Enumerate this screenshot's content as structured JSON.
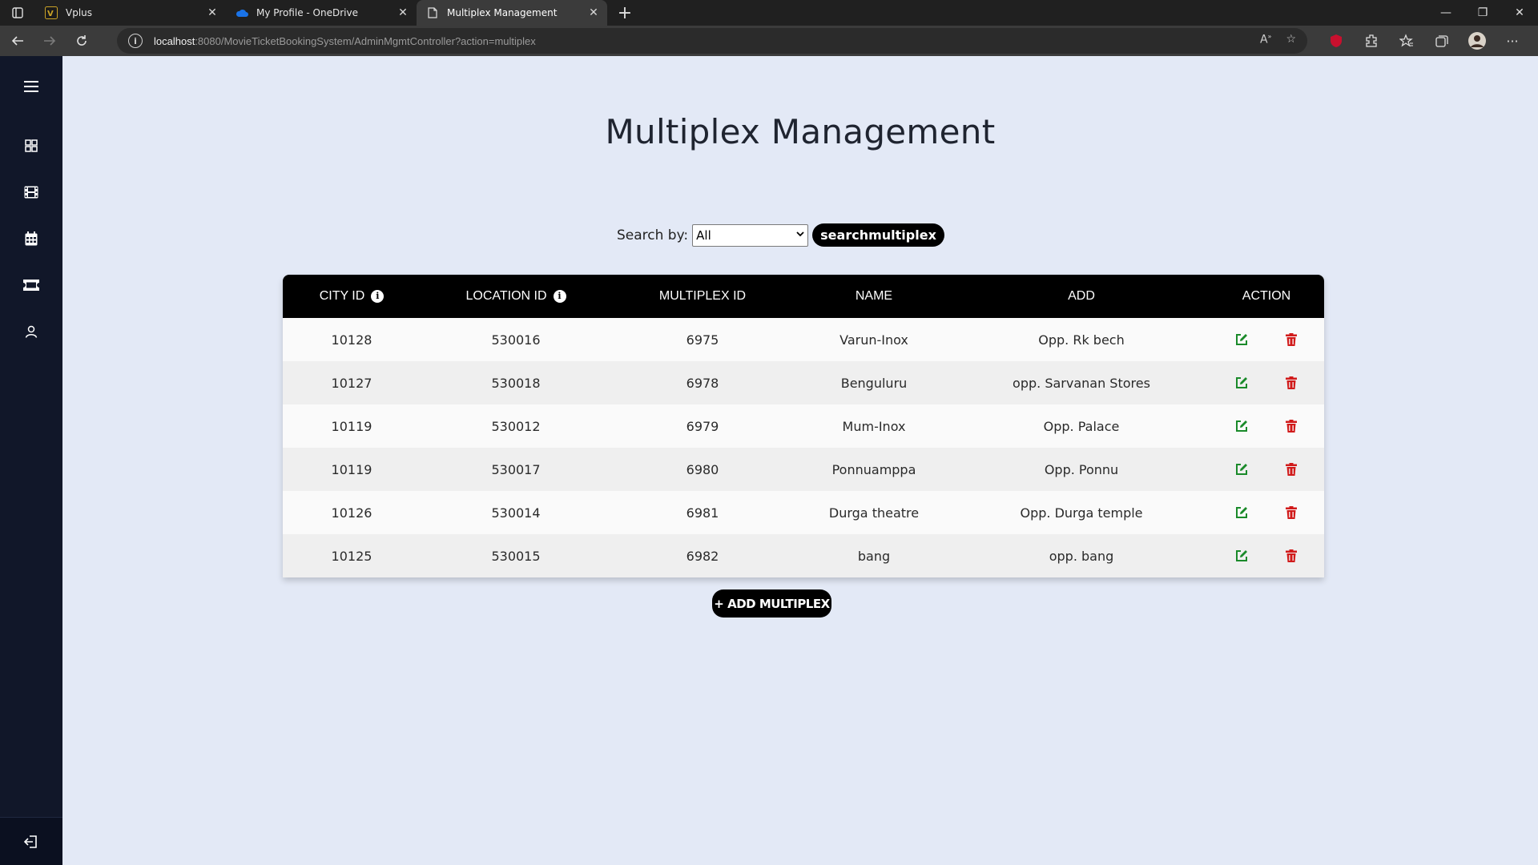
{
  "browser": {
    "tabs": [
      {
        "title": "Vplus",
        "favicon": "vplus-icon"
      },
      {
        "title": "My Profile - OneDrive",
        "favicon": "onedrive-icon"
      },
      {
        "title": "Multiplex Management",
        "favicon": "page-icon"
      }
    ],
    "url_host": "localhost",
    "url_rest": ":8080/MovieTicketBookingSystem/AdminMgmtController?action=multiplex"
  },
  "sidebar": {
    "items": [
      {
        "name": "menu-icon"
      },
      {
        "name": "dashboard-icon"
      },
      {
        "name": "film-icon"
      },
      {
        "name": "calendar-icon"
      },
      {
        "name": "ticket-icon"
      },
      {
        "name": "user-icon"
      }
    ],
    "logout": "logout-icon"
  },
  "page": {
    "title": "Multiplex Management",
    "search_label": "Search by:",
    "search_value": "All",
    "search_button": "searchmultiplex",
    "add_button": "+ ADD MULTIPLEX"
  },
  "table": {
    "headers": [
      "CITY ID",
      "LOCATION ID",
      "MULTIPLEX ID",
      "NAME",
      "ADD",
      "ACTION"
    ],
    "rows": [
      {
        "city": "10128",
        "location": "530016",
        "multiplex": "6975",
        "name": "Varun-Inox",
        "add": "Opp. Rk bech"
      },
      {
        "city": "10127",
        "location": "530018",
        "multiplex": "6978",
        "name": "Benguluru",
        "add": "opp. Sarvanan Stores"
      },
      {
        "city": "10119",
        "location": "530012",
        "multiplex": "6979",
        "name": "Mum-Inox",
        "add": "Opp. Palace"
      },
      {
        "city": "10119",
        "location": "530017",
        "multiplex": "6980",
        "name": "Ponnuamppa",
        "add": "Opp. Ponnu"
      },
      {
        "city": "10126",
        "location": "530014",
        "multiplex": "6981",
        "name": "Durga theatre",
        "add": "Opp. Durga temple"
      },
      {
        "city": "10125",
        "location": "530015",
        "multiplex": "6982",
        "name": "bang",
        "add": "opp. bang"
      }
    ]
  },
  "colors": {
    "edit": "#1a8a2a",
    "delete": "#d11a1a",
    "sidebar_bg": "#111729",
    "page_bg": "#e3e9f6"
  }
}
